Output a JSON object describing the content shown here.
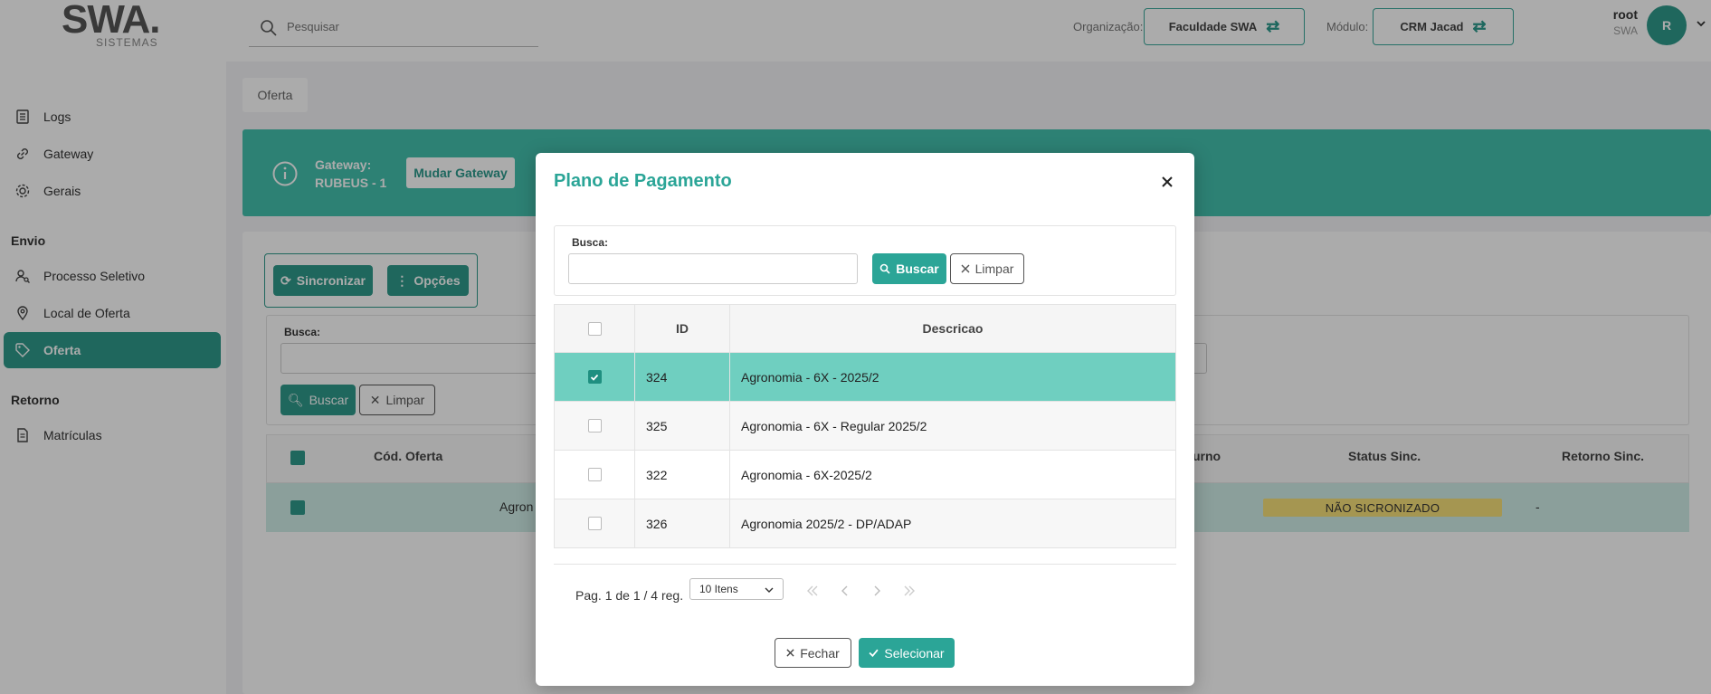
{
  "header": {
    "logo_text": "SWA.",
    "logo_sub": "SISTEMAS",
    "search_placeholder": "Pesquisar",
    "org_label": "Organização:",
    "org_value": "Faculdade SWA",
    "module_label": "Módulo:",
    "module_value": "CRM Jacad",
    "user_name": "root",
    "user_org": "SWA",
    "avatar_initial": "R"
  },
  "sidebar": {
    "items_top": [
      {
        "label": "Logs",
        "icon": "logs-icon"
      },
      {
        "label": "Gateway",
        "icon": "link-icon"
      },
      {
        "label": "Gerais",
        "icon": "gear-icon"
      }
    ],
    "section_envio": "Envio",
    "items_envio": [
      {
        "label": "Processo Seletivo",
        "icon": "user-search-icon"
      },
      {
        "label": "Local de Oferta",
        "icon": "map-pin-icon"
      },
      {
        "label": "Oferta",
        "icon": "tag-icon",
        "active": true
      }
    ],
    "section_retorno": "Retorno",
    "items_retorno": [
      {
        "label": "Matrículas",
        "icon": "document-icon"
      }
    ]
  },
  "main": {
    "tab": "Oferta",
    "gateway_label": "Gateway:",
    "gateway_value": "RUBEUS - 1",
    "gateway_button": "Mudar Gateway",
    "sync_button": "Sincronizar",
    "options_button": "Opções",
    "search_label": "Busca:",
    "search_button": "Buscar",
    "clear_button": "Limpar",
    "table_headers": {
      "cod": "Cód. Oferta",
      "turno": "urno",
      "status": "Status Sinc.",
      "retorno": "Retorno Sinc."
    },
    "row": {
      "text": "Agron",
      "status": "NÃO SICRONIZADO",
      "retorno": "-"
    }
  },
  "modal": {
    "title": "Plano de Pagamento",
    "search_label": "Busca:",
    "search_value": "",
    "search_button": "Buscar",
    "clear_button": "Limpar",
    "columns": {
      "id": "ID",
      "desc": "Descricao"
    },
    "rows": [
      {
        "id": "324",
        "desc": "Agronomia - 6X - 2025/2",
        "selected": true
      },
      {
        "id": "325",
        "desc": "Agronomia - 6X - Regular 2025/2",
        "selected": false
      },
      {
        "id": "322",
        "desc": "Agronomia - 6X-2025/2",
        "selected": false
      },
      {
        "id": "326",
        "desc": "Agronomia 2025/2 - DP/ADAP",
        "selected": false
      }
    ],
    "pagination": "Pag. 1 de 1 / 4 reg.",
    "page_size": "10 Itens",
    "close_button": "Fechar",
    "select_button": "Selecionar"
  },
  "colors": {
    "accent": "#2f9a8b",
    "accent_light": "#6fcfc0",
    "badge": "#f7e07a"
  }
}
